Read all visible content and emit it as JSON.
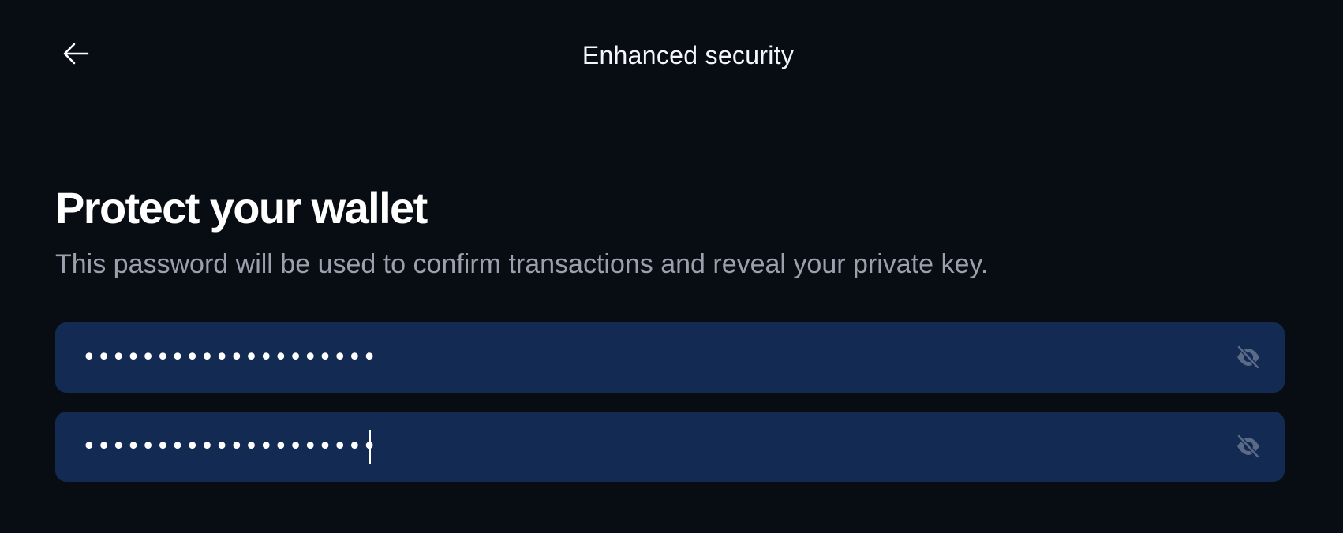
{
  "header": {
    "title": "Enhanced security",
    "back_icon": "arrow-left-icon"
  },
  "main": {
    "title": "Protect your wallet",
    "subtitle": "This password will be used to confirm transactions and reveal your private key."
  },
  "fields": [
    {
      "name": "password",
      "value": "••••••••••••••••••••",
      "type": "password",
      "toggle_icon": "eye-off-icon"
    },
    {
      "name": "confirm-password",
      "value": "••••••••••••••••••••",
      "type": "password",
      "toggle_icon": "eye-off-icon",
      "focused": true
    }
  ],
  "colors": {
    "background": "#080c13",
    "field_background": "#132b53",
    "text_primary": "#ffffff",
    "text_secondary": "#9aa1ad",
    "icon_muted": "#5b6a86"
  }
}
